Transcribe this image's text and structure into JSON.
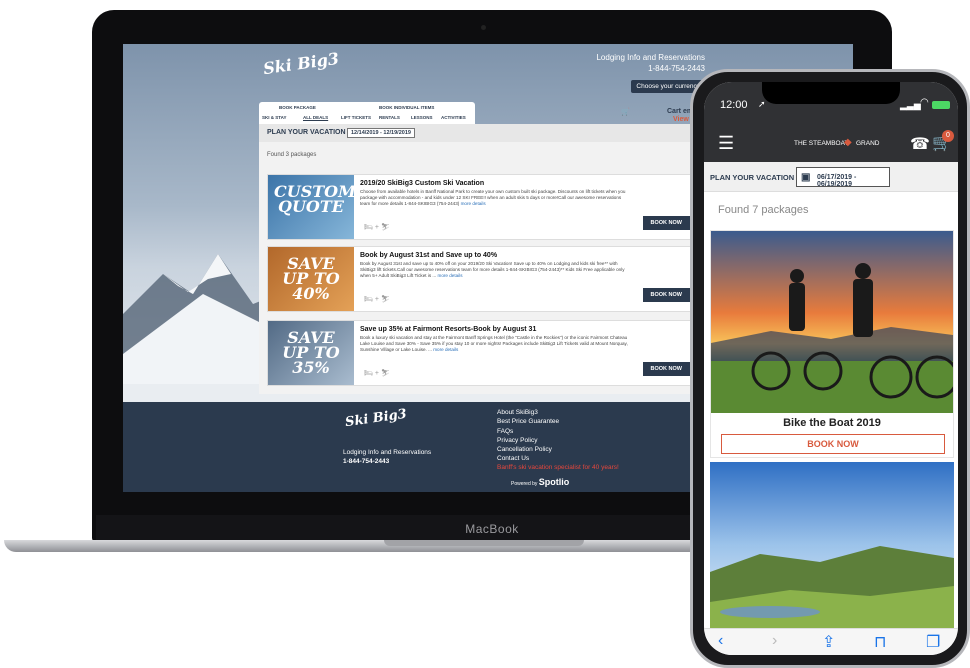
{
  "laptop": {
    "brand_label": "MacBook",
    "site": {
      "logo_text": "Ski Big3",
      "contact_label": "Lodging Info and Reservations",
      "phone": "1-844-754-2443",
      "currency_button": "Choose your currency",
      "book_package_label": "BOOK PACKAGE",
      "book_items_label": "BOOK INDIVIDUAL ITEMS",
      "tabs": [
        "SKI & STAY",
        "ALL DEALS",
        "LIFT TICKETS",
        "RENTALS",
        "LESSONS",
        "ACTIVITIES"
      ],
      "cart_text": "Cart em",
      "cart_view": "View",
      "plan_label": "PLAN YOUR VACATION",
      "date_range": "12/14/2019 - 12/19/2019",
      "found_text": "Found 3 packages",
      "book_now": "BOOK NOW",
      "packages": [
        {
          "title": "2019/20 SkiBig3 Custom Ski Vacation",
          "image_text": "CUSTOM QUOTE",
          "description": "Choose from available hotels in Banff National Park to create your own custom built ski package. Discounts on lift tickets when you package with accommodation - and kids under 12 SKI FREE!! when an adult skis 5 days or more!Call our awesome reservations team for more details 1-844-SKIBIG3 (754-2443)",
          "more": "more details"
        },
        {
          "title": "Book by August 31st and Save up to 40%",
          "image_text": "SAVE UP TO 40%",
          "description": "Book by August 31st and save up to 40% off on your 2019/20 Ski Vacation! Save up to 40% on Lodging and kids ski free** with SkiBig3 lift tickets.Call our awesome reservations team for more details 1-844-SKIBIG3 (754-2443)** Kids Ski Free applicable only when 5+ Adult SkiBig3 Lift Ticket is ...",
          "more": "more details"
        },
        {
          "title": "Save up 35% at Fairmont Resorts-Book by August 31",
          "image_text": "SAVE UP TO 35%",
          "description": "Book a luxury ski vacation and stay at the Fairmont Banff Springs Hotel (the \"Castle in the Rockies\") or the iconic Fairmont Chateau Lake Louise and Save 30% - Save 35% if you stay 10 or more nights! Packages include SkiBig3 Lift Tickets valid at Mount Norquay, Sunshine Village or Lake Louise. ...",
          "more": "more details"
        }
      ],
      "footer": {
        "contact_label": "Lodging Info and Reservations",
        "phone": "1-844-754-2443",
        "links": [
          "About SkiBig3",
          "Best Price Guarantee",
          "FAQs",
          "Privacy Policy",
          "Cancellation Policy",
          "Contact Us"
        ],
        "specialist": "Banff's ski vacation specialist for 40 years!",
        "powered_by": "Powered by",
        "powered_brand": "Spotlio"
      }
    }
  },
  "phone": {
    "time": "12:00",
    "brand": "THE STEAMBOAT",
    "brand2": "GRAND",
    "cart_count": "0",
    "plan_label": "PLAN YOUR VACATION",
    "date_range": "06/17/2019 - 06/19/2019",
    "found_text": "Found 7 packages",
    "card_title": "Bike the Boat 2019",
    "book_now": "BOOK NOW"
  }
}
